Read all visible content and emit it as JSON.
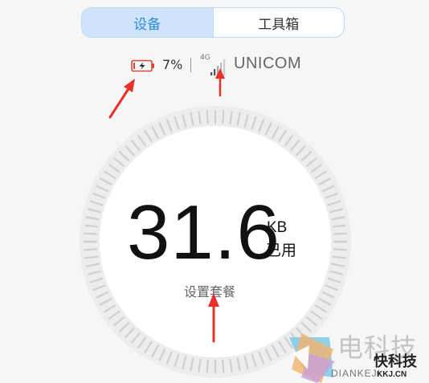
{
  "tabs": [
    {
      "label": "设备",
      "active": true
    },
    {
      "label": "工具箱",
      "active": false
    }
  ],
  "status": {
    "battery_icon": "battery-charging-icon",
    "battery_percent": "7%",
    "network_type": "4G",
    "signal_icon": "signal-icon",
    "carrier": "UNICOM"
  },
  "usage": {
    "value": "31.6",
    "unit": "KB",
    "label": "已用"
  },
  "plan_link": "设置套餐",
  "colors": {
    "accent": "#2f8ae2",
    "tab_active_bg": "#cfe4fa",
    "arrow": "#e8302a"
  },
  "watermark": {
    "line1": "电科技",
    "line2": "快科技",
    "line3": "DIANKEJI",
    "line4": "KKJ.CN"
  }
}
